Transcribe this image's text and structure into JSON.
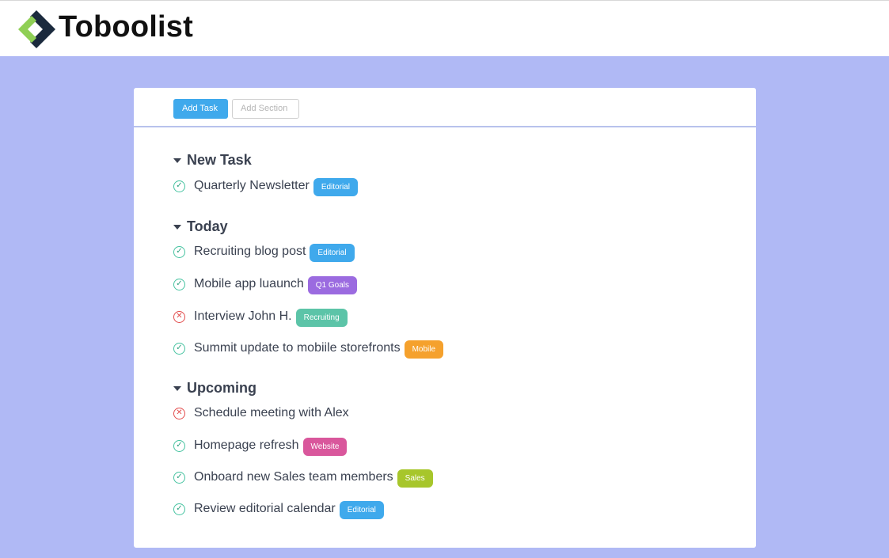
{
  "app": {
    "name": "Toboolist"
  },
  "toolbar": {
    "add_task_label": "Add Task",
    "add_section_label": "Add Section"
  },
  "sections": [
    {
      "title": "New Task",
      "tasks": [
        {
          "label": "Quarterly Newsletter",
          "status": "done",
          "tag": "Editorial",
          "tag_color": "#3fa9ec"
        }
      ]
    },
    {
      "title": "Today",
      "tasks": [
        {
          "label": "Recruiting blog post",
          "status": "done",
          "tag": "Editorial",
          "tag_color": "#3fa9ec"
        },
        {
          "label": "Mobile app luaunch",
          "status": "done",
          "tag": "Q1 Goals",
          "tag_color": "#9b6be0"
        },
        {
          "label": "Interview John H.",
          "status": "failed",
          "tag": "Recruiting",
          "tag_color": "#5cc4a8"
        },
        {
          "label": "Summit update to mobiile storefronts",
          "status": "done",
          "tag": "Mobile",
          "tag_color": "#f5a12d"
        }
      ]
    },
    {
      "title": "Upcoming",
      "tasks": [
        {
          "label": "Schedule meeting with Alex",
          "status": "failed",
          "tag": "",
          "tag_color": ""
        },
        {
          "label": "Homepage refresh",
          "status": "done",
          "tag": "Website",
          "tag_color": "#d9579c"
        },
        {
          "label": "Onboard new Sales team members",
          "status": "done",
          "tag": "Sales",
          "tag_color": "#a7c62b"
        },
        {
          "label": "Review editorial calendar",
          "status": "done",
          "tag": "Editorial",
          "tag_color": "#3fa9ec"
        }
      ]
    }
  ],
  "icons": {
    "done": "check-circle-icon",
    "failed": "x-circle-icon",
    "section_toggle": "caret-down-icon",
    "logo": "toboolist-logo-icon"
  },
  "colors": {
    "background": "#b0b9f5",
    "accent": "#3fa9ec"
  }
}
